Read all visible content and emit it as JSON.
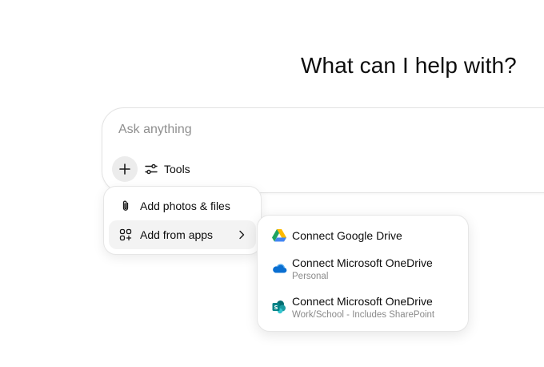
{
  "heading": "What can I help with?",
  "composer": {
    "placeholder": "Ask anything",
    "add_button": "plus-icon",
    "tools_label": "Tools",
    "tools_icon": "sliders-icon"
  },
  "attach_menu": {
    "items": [
      {
        "label": "Add photos & files",
        "icon": "paperclip-icon"
      },
      {
        "label": "Add from apps",
        "icon": "apps-grid-icon",
        "has_submenu": true
      }
    ]
  },
  "apps_submenu": {
    "items": [
      {
        "title": "Connect Google Drive",
        "subtitle": "",
        "icon": "google-drive-icon"
      },
      {
        "title": "Connect Microsoft OneDrive",
        "subtitle": "Personal",
        "icon": "onedrive-icon"
      },
      {
        "title": "Connect Microsoft OneDrive",
        "subtitle": "Work/School - Includes SharePoint",
        "icon": "sharepoint-icon"
      }
    ]
  },
  "colors": {
    "gdrive_green": "#1ea362",
    "gdrive_yellow": "#ffba00",
    "gdrive_blue": "#4285f4",
    "onedrive_blue": "#0a6fd1",
    "sharepoint_teal": "#038387"
  }
}
